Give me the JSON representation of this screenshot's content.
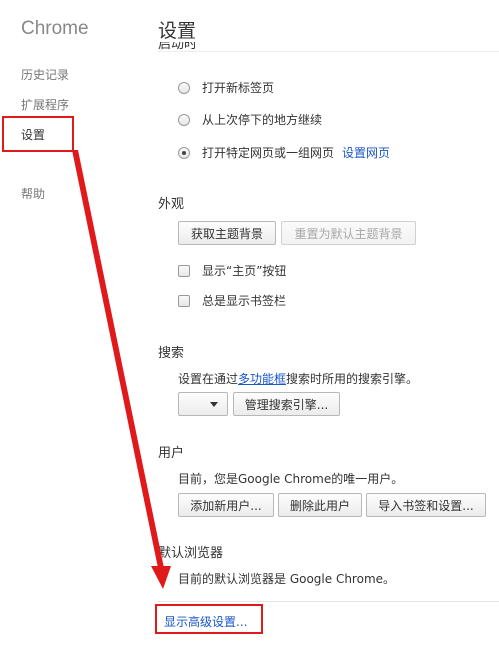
{
  "sidebar": {
    "brand": "Chrome",
    "items": [
      {
        "label": "历史记录"
      },
      {
        "label": "扩展程序"
      },
      {
        "label": "设置"
      },
      {
        "label": "帮助"
      }
    ]
  },
  "main": {
    "title": "设置",
    "startup": {
      "heading_fragment": "启动时",
      "options": [
        {
          "label": "打开新标签页",
          "checked": false
        },
        {
          "label": "从上次停下的地方继续",
          "checked": false
        },
        {
          "label": "打开特定网页或一组网页",
          "checked": true,
          "link": "设置网页"
        }
      ]
    },
    "appearance": {
      "heading": "外观",
      "get_theme": "获取主题背景",
      "reset_theme": "重置为默认主题背景",
      "show_home": "显示“主页”按钮",
      "show_bookmarks": "总是显示书签栏"
    },
    "search": {
      "heading": "搜索",
      "desc_prefix": "设置在通过",
      "desc_link": "多功能框",
      "desc_suffix": "搜索时所用的搜索引擎。",
      "select_value": "",
      "manage": "管理搜索引擎..."
    },
    "users": {
      "heading": "用户",
      "desc": "目前，您是Google Chrome的唯一用户。",
      "add": "添加新用户...",
      "delete": "删除此用户",
      "import": "导入书签和设置..."
    },
    "default_browser": {
      "heading": "默认浏览器",
      "desc": "目前的默认浏览器是 Google Chrome。"
    },
    "advanced_link": "显示高级设置..."
  },
  "colors": {
    "highlight": "#e01a1a",
    "link": "#1a57c8"
  }
}
